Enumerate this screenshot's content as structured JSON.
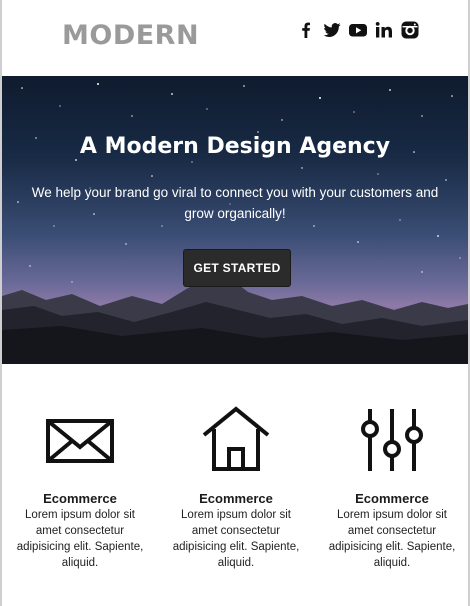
{
  "header": {
    "logo": "MODERN",
    "social": [
      {
        "name": "facebook-icon"
      },
      {
        "name": "twitter-icon"
      },
      {
        "name": "youtube-icon"
      },
      {
        "name": "linkedin-icon"
      },
      {
        "name": "instagram-icon"
      }
    ]
  },
  "hero": {
    "title": "A Modern Design Agency",
    "subtitle": "We help your brand go viral to connect you with your customers and grow organically!",
    "cta_label": "GET STARTED",
    "cta_color": "#2b2b2b"
  },
  "features": [
    {
      "icon": "envelope-icon",
      "title": "Ecommerce",
      "text": "Lorem ipsum dolor sit amet consectetur adipisicing elit. Sapiente, aliquid."
    },
    {
      "icon": "house-icon",
      "title": "Ecommerce",
      "text": "Lorem ipsum dolor sit amet consectetur adipisicing elit. Sapiente, aliquid."
    },
    {
      "icon": "sliders-icon",
      "title": "Ecommerce",
      "text": "Lorem ipsum dolor sit amet consectetur adipisicing elit. Sapiente, aliquid."
    }
  ]
}
